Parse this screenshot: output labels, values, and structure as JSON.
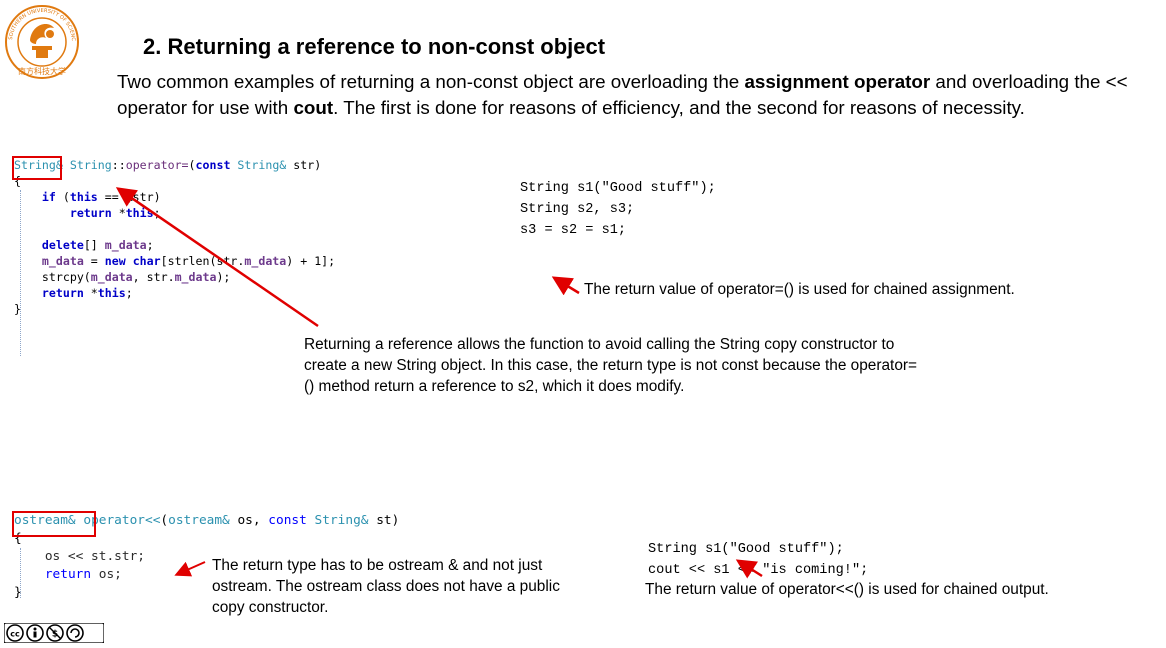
{
  "title": "2. Returning a reference to non-const object",
  "intro": {
    "t1": "Two common examples of returning a non-const object are overloading the ",
    "b1": "assignment operator",
    "t2": " and overloading the << operator for use with ",
    "b2": "cout",
    "t3": ". The first is done for reasons of efficiency, and the second for reasons of necessity."
  },
  "logo": {
    "text_top": "SOUTHERN UNIVERSITY OF SCIENCE AND TECHNOLOGY",
    "text_bottom": "南方科技大学"
  },
  "code1": {
    "l1": [
      "String&",
      " ",
      "String",
      "::",
      "operator=",
      "(",
      "const",
      " ",
      "String&",
      " str)"
    ],
    "l2": "{",
    "l3": [
      "    ",
      "if",
      " (",
      "this",
      " == &str)"
    ],
    "l4": [
      "        ",
      "return",
      " *",
      "this",
      ";"
    ],
    "l6": [
      "    ",
      "delete",
      "[] ",
      "m_data",
      ";"
    ],
    "l7": [
      "    ",
      "m_data",
      " = ",
      "new",
      " ",
      "char",
      "[strlen(str.",
      "m_data",
      ") + 1];"
    ],
    "l8": [
      "    strcpy(",
      "m_data",
      ", str.",
      "m_data",
      ");"
    ],
    "l9": [
      "    ",
      "return",
      " *",
      "this",
      ";"
    ],
    "l10": "}"
  },
  "example1": [
    "String s1(\"Good stuff\");",
    "String s2, s3;",
    "s3 = s2 = s1;"
  ],
  "note1": "The return value of operator=() is used for chained assignment.",
  "note2": "Returning a reference allows the function to avoid calling the String copy constructor to create a new String object. In this case, the return type is not const because the operator=() method return a reference to s2, which it does modify.",
  "code2": {
    "l1": [
      "ostream&",
      " ",
      "operator<<",
      "(",
      "ostream&",
      " os, ",
      "const",
      " ",
      "String&",
      " st)"
    ],
    "l2": "{",
    "l3": "    os << st.str;",
    "l4": [
      "    ",
      "return",
      " os;"
    ],
    "l5": "}"
  },
  "note3": "The return type has to be ostream & and not just ostream. The ostream class does not have a  public copy constructor.",
  "example2": [
    "String s1(\"Good stuff\");",
    "cout << s1 << \"is coming!\";"
  ],
  "note4": "The return value of operator<<() is used for chained output.",
  "license": "cc by nc sa",
  "colors": {
    "accent_red": "#e00000",
    "keyword_blue": "#0000c8",
    "type_teal": "#2b91af",
    "logo_orange": "#e07a10"
  }
}
